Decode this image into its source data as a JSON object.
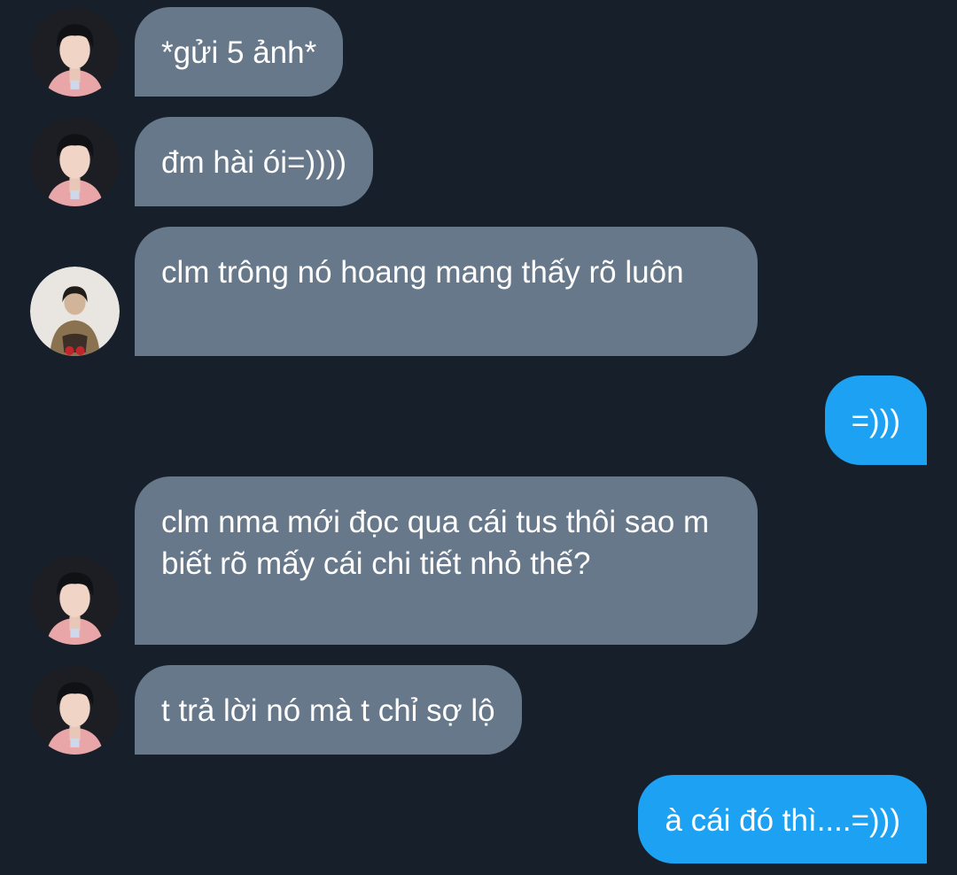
{
  "conversation": {
    "messages": [
      {
        "direction": "incoming",
        "avatar": "avatar-pink-shirt",
        "text": "*gửi 5 ảnh*"
      },
      {
        "direction": "incoming",
        "avatar": "avatar-pink-shirt",
        "text": "đm hài ói=))))"
      },
      {
        "direction": "incoming",
        "avatar": "avatar-brown-jacket",
        "text": "clm trông nó hoang mang thấy rõ luôn"
      },
      {
        "direction": "outgoing",
        "text": "=)))"
      },
      {
        "direction": "incoming",
        "avatar": "avatar-pink-shirt",
        "text": "clm nma mới đọc qua cái tus thôi sao m biết rõ mấy cái chi tiết nhỏ thế?"
      },
      {
        "direction": "incoming",
        "avatar": "avatar-pink-shirt",
        "text": "t trả lời nó mà t chỉ sợ lộ"
      },
      {
        "direction": "outgoing",
        "text": "à cái đó thì....=)))"
      }
    ]
  },
  "colors": {
    "background": "#17202a",
    "incoming_bubble": "#66788a",
    "outgoing_bubble": "#1da1f2",
    "text": "#ffffff"
  }
}
